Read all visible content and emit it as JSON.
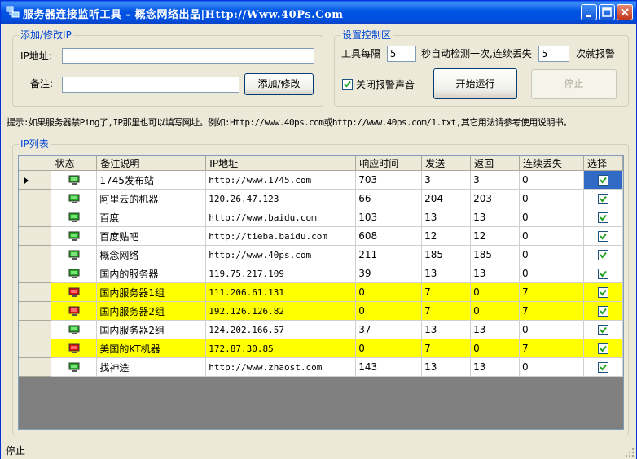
{
  "window": {
    "title": "服务器连接监听工具 - 概念网络出品|Http://Www.40Ps.Com",
    "controls": [
      "minimize",
      "maximize",
      "close"
    ]
  },
  "add_edit": {
    "group_title": "添加/修改IP",
    "ip_label": "IP地址:",
    "ip_value": "",
    "note_label": "备注:",
    "note_value": "",
    "submit_label": "添加/修改"
  },
  "settings": {
    "group_title": "设置控制区",
    "interval_prefix": "工具每隔",
    "interval_value": "5",
    "interval_mid": "秒自动检测一次,连续丢失",
    "loss_value": "5",
    "loss_suffix": "次就报警",
    "mute_label": "关闭报警声音",
    "mute_checked": true,
    "start_label": "开始运行",
    "stop_label": "停止"
  },
  "hint": "提示:如果服务器禁Ping了,IP那里也可以填写网址。例如:Http://www.40ps.com或http://www.40ps.com/1.txt,其它用法请参考使用说明书。",
  "ip_list": {
    "group_title": "IP列表",
    "columns": [
      "状态",
      "备注说明",
      "IP地址",
      "响应时间",
      "发送",
      "返回",
      "连续丢失",
      "选择"
    ],
    "rows": [
      {
        "status": "ok",
        "note": "1745发布站",
        "ip": "http://www.1745.com",
        "response": "703",
        "sent": "3",
        "returned": "3",
        "lost": "0",
        "selected": true
      },
      {
        "status": "ok",
        "note": "阿里云的机器",
        "ip": "120.26.47.123",
        "response": "66",
        "sent": "204",
        "returned": "203",
        "lost": "0",
        "selected": true
      },
      {
        "status": "ok",
        "note": "百度",
        "ip": "http://www.baidu.com",
        "response": "103",
        "sent": "13",
        "returned": "13",
        "lost": "0",
        "selected": true
      },
      {
        "status": "ok",
        "note": "百度贴吧",
        "ip": "http://tieba.baidu.com",
        "response": "608",
        "sent": "12",
        "returned": "12",
        "lost": "0",
        "selected": true
      },
      {
        "status": "ok",
        "note": "概念网络",
        "ip": "http://www.40ps.com",
        "response": "211",
        "sent": "185",
        "returned": "185",
        "lost": "0",
        "selected": true
      },
      {
        "status": "ok",
        "note": "国内的服务器",
        "ip": "119.75.217.109",
        "response": "39",
        "sent": "13",
        "returned": "13",
        "lost": "0",
        "selected": true
      },
      {
        "status": "alarm",
        "note": "国内服务器1组",
        "ip": "111.206.61.131",
        "response": "0",
        "sent": "7",
        "returned": "0",
        "lost": "7",
        "selected": true
      },
      {
        "status": "alarm",
        "note": "国内服务器2组",
        "ip": "192.126.126.82",
        "response": "0",
        "sent": "7",
        "returned": "0",
        "lost": "7",
        "selected": true
      },
      {
        "status": "ok",
        "note": "国内服务器2组",
        "ip": "124.202.166.57",
        "response": "37",
        "sent": "13",
        "returned": "13",
        "lost": "0",
        "selected": true
      },
      {
        "status": "alarm",
        "note": "美国的KT机器",
        "ip": "172.87.30.85",
        "response": "0",
        "sent": "7",
        "returned": "0",
        "lost": "7",
        "selected": true
      },
      {
        "status": "ok",
        "note": "找神途",
        "ip": "http://www.zhaost.com",
        "response": "143",
        "sent": "13",
        "returned": "13",
        "lost": "0",
        "selected": true
      }
    ]
  },
  "statusbar": {
    "text": "停止"
  },
  "colors": {
    "alarm_row": "#ffff00",
    "ok_icon": "#22aa22",
    "alarm_icon": "#dd1111",
    "accent": "#0046d5"
  }
}
